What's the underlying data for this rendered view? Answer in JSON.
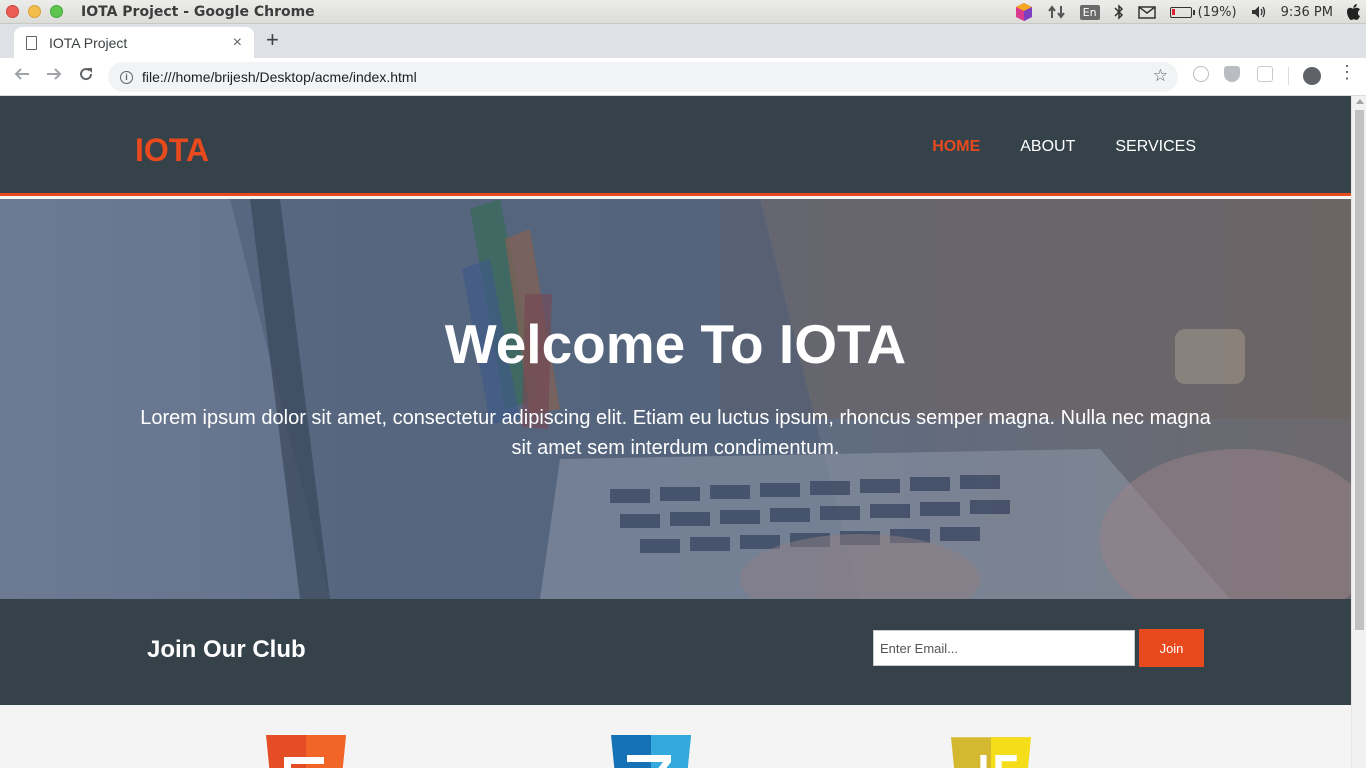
{
  "os": {
    "window_title": "IOTA Project - Google Chrome",
    "lang": "En",
    "battery": "(19%)",
    "battery_level": 0.19,
    "clock": "9:36 PM"
  },
  "browser": {
    "tab_title": "IOTA Project",
    "tab_close": "×",
    "new_tab": "+",
    "url": "file:///home/brijesh/Desktop/acme/index.html",
    "menu": "⋮"
  },
  "site": {
    "logo": "IOTA",
    "nav": [
      {
        "label": "HOME",
        "current": true
      },
      {
        "label": "ABOUT",
        "current": false
      },
      {
        "label": "SERVICES",
        "current": false
      }
    ],
    "hero": {
      "title": "Welcome To IOTA",
      "text": "Lorem ipsum dolor sit amet, consectetur adipiscing elit. Etiam eu luctus ipsum, rhoncus semper magna. Nulla nec magna sit amet sem interdum condimentum."
    },
    "newsletter": {
      "heading": "Join Our Club",
      "email_placeholder": "Enter Email...",
      "button": "Join"
    },
    "badges": [
      "html5-logo",
      "css3-logo",
      "js-logo"
    ]
  },
  "colors": {
    "accent": "#e8491d",
    "header_bg": "#35424a",
    "page_bg": "#f4f4f4"
  }
}
